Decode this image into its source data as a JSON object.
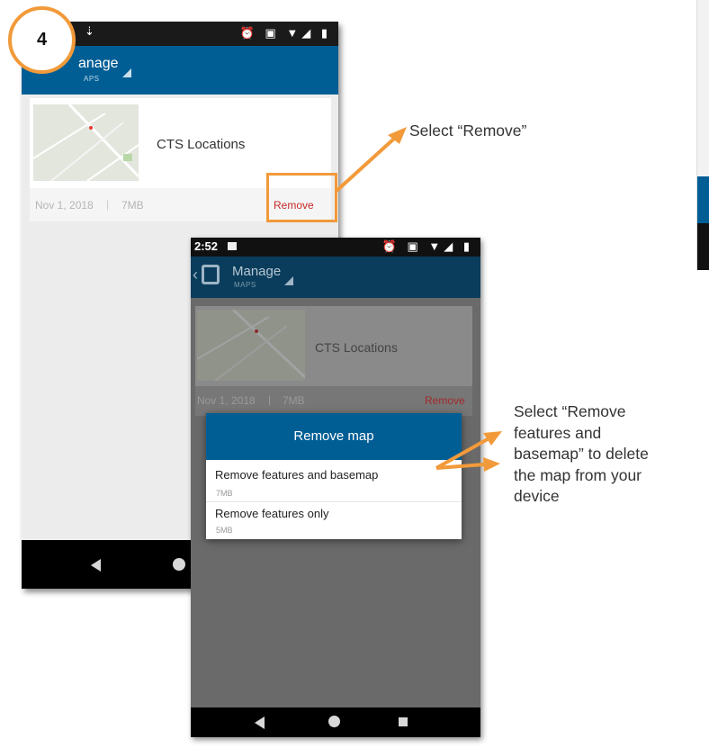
{
  "step": {
    "number": "4"
  },
  "phone1": {
    "app_title": "anage",
    "app_subtitle": "APS",
    "card": {
      "title": "CTS Locations",
      "date": "Nov 1, 2018",
      "separator": "|",
      "size": "7MB",
      "remove_label": "Remove"
    }
  },
  "phone2": {
    "time": "2:52",
    "app_title": "Manage",
    "app_subtitle": "MAPS",
    "card": {
      "title": "CTS Locations",
      "date": "Nov 1, 2018",
      "separator": "|",
      "size": "7MB",
      "remove_label": "Remove"
    },
    "dialog": {
      "title": "Remove map",
      "options": [
        {
          "label": "Remove features and basemap",
          "size": "7MB"
        },
        {
          "label": "Remove features only",
          "size": "5MB"
        }
      ]
    }
  },
  "callouts": {
    "remove": "Select “Remove”",
    "basemap": [
      "Select “Remove",
      "features and",
      "basemap” to delete",
      "the map from your",
      "device"
    ]
  },
  "colors": {
    "appbar": "#005e95",
    "accent": "#f29a3a",
    "remove": "#c62828"
  }
}
